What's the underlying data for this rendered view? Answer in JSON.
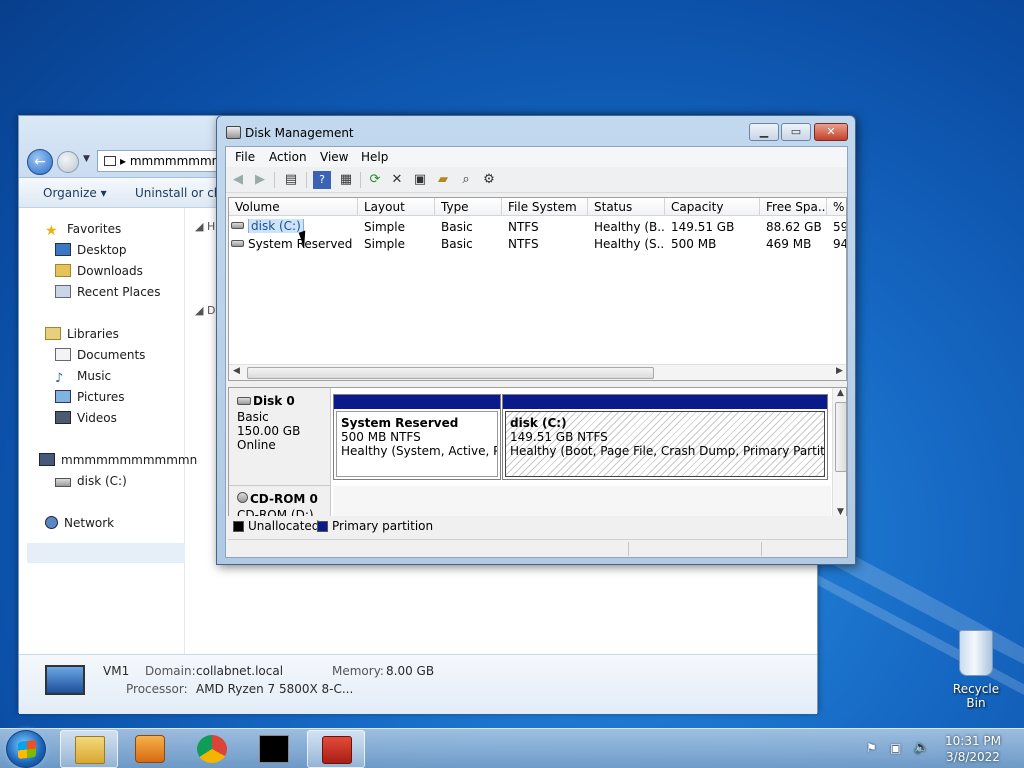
{
  "explorer": {
    "address": "mmmmmmmm",
    "toolbar": {
      "organize": "Organize ▾",
      "uninstall": "Uninstall or cha"
    },
    "sidebar": {
      "favorites": "Favorites",
      "desktop": "Desktop",
      "downloads": "Downloads",
      "recent_places": "Recent Places",
      "libraries": "Libraries",
      "documents": "Documents",
      "music": "Music",
      "pictures": "Pictures",
      "videos": "Videos",
      "computer": "mmmmmmmmmmmn",
      "disk_c": "disk (C:)",
      "network": "Network"
    },
    "main_glyphs": {
      "h": "H",
      "d": "D"
    },
    "status": {
      "name": "VM1",
      "domain_label": "Domain:",
      "domain_value": "collabnet.local",
      "memory_label": "Memory:",
      "memory_value": "8.00 GB",
      "processor_label": "Processor:",
      "processor_value": "AMD Ryzen 7 5800X 8-C..."
    }
  },
  "disk_management": {
    "title": "Disk Management",
    "menu": [
      "File",
      "Action",
      "View",
      "Help"
    ],
    "columns": [
      "Volume",
      "Layout",
      "Type",
      "File System",
      "Status",
      "Capacity",
      "Free Spa...",
      "% F"
    ],
    "volumes": [
      {
        "volume": "disk (C:)",
        "layout": "Simple",
        "type": "Basic",
        "fs": "NTFS",
        "status": "Healthy (B...",
        "capacity": "149.51 GB",
        "free": "88.62 GB",
        "pct": "59"
      },
      {
        "volume": "System Reserved",
        "layout": "Simple",
        "type": "Basic",
        "fs": "NTFS",
        "status": "Healthy (S...",
        "capacity": "500 MB",
        "free": "469 MB",
        "pct": "94"
      }
    ],
    "disks": {
      "disk0": {
        "name": "Disk 0",
        "type": "Basic",
        "size": "150.00 GB",
        "state": "Online"
      },
      "cdrom0": {
        "name": "CD-ROM 0",
        "drive": "CD-ROM (D:)"
      }
    },
    "partitions": {
      "reserved": {
        "name": "System Reserved",
        "size": "500 MB NTFS",
        "status": "Healthy (System, Active, Prim"
      },
      "c": {
        "name": "disk  (C:)",
        "size": "149.51 GB NTFS",
        "status": "Healthy (Boot, Page File, Crash Dump, Primary Partition)"
      }
    },
    "legend": {
      "unallocated": "Unallocated",
      "primary": "Primary partition"
    },
    "colors": {
      "primary": "#0a1a8a",
      "unallocated": "#000000"
    }
  },
  "desktop": {
    "recycle_bin": "Recycle Bin"
  },
  "taskbar": {
    "time": "10:31 PM",
    "date": "3/8/2022"
  }
}
